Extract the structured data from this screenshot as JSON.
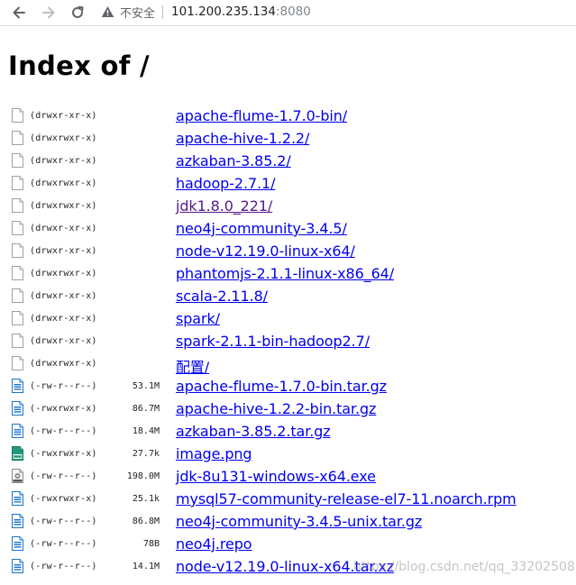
{
  "browser": {
    "security_label": "不安全",
    "url_host": "101.200.235.134",
    "url_port": ":8080"
  },
  "page": {
    "title": "Index of /"
  },
  "entries": [
    {
      "perm": "(drwxr-xr-x)",
      "size": "",
      "name": "apache-flume-1.7.0-bin/",
      "icon": "folder-icon",
      "visited": false
    },
    {
      "perm": "(drwxrwxr-x)",
      "size": "",
      "name": "apache-hive-1.2.2/",
      "icon": "folder-icon",
      "visited": false
    },
    {
      "perm": "(drwxr-xr-x)",
      "size": "",
      "name": "azkaban-3.85.2/",
      "icon": "folder-icon",
      "visited": false
    },
    {
      "perm": "(drwxrwxr-x)",
      "size": "",
      "name": "hadoop-2.7.1/",
      "icon": "folder-icon",
      "visited": false
    },
    {
      "perm": "(drwxrwxr-x)",
      "size": "",
      "name": "jdk1.8.0_221/",
      "icon": "folder-icon",
      "visited": true
    },
    {
      "perm": "(drwxr-xr-x)",
      "size": "",
      "name": "neo4j-community-3.4.5/",
      "icon": "folder-icon",
      "visited": false
    },
    {
      "perm": "(drwxr-xr-x)",
      "size": "",
      "name": "node-v12.19.0-linux-x64/",
      "icon": "folder-icon",
      "visited": false
    },
    {
      "perm": "(drwxrwxr-x)",
      "size": "",
      "name": "phantomjs-2.1.1-linux-x86_64/",
      "icon": "folder-icon",
      "visited": false
    },
    {
      "perm": "(drwxr-xr-x)",
      "size": "",
      "name": "scala-2.11.8/",
      "icon": "folder-icon",
      "visited": false
    },
    {
      "perm": "(drwxr-xr-x)",
      "size": "",
      "name": "spark/",
      "icon": "folder-icon",
      "visited": false
    },
    {
      "perm": "(drwxr-xr-x)",
      "size": "",
      "name": "spark-2.1.1-bin-hadoop2.7/",
      "icon": "folder-icon",
      "visited": false
    },
    {
      "perm": "(drwxrwxr-x)",
      "size": "",
      "name": "配置/",
      "icon": "folder-icon",
      "visited": false
    },
    {
      "perm": "(-rw-r--r--)",
      "size": "53.1M",
      "name": "apache-flume-1.7.0-bin.tar.gz",
      "icon": "archive-icon",
      "visited": false
    },
    {
      "perm": "(-rwxrwxr-x)",
      "size": "86.7M",
      "name": "apache-hive-1.2.2-bin.tar.gz",
      "icon": "archive-icon",
      "visited": false
    },
    {
      "perm": "(-rw-r--r--)",
      "size": "18.4M",
      "name": "azkaban-3.85.2.tar.gz",
      "icon": "archive-icon",
      "visited": false
    },
    {
      "perm": "(-rwxrwxr-x)",
      "size": "27.7k",
      "name": "image.png",
      "icon": "image-icon",
      "visited": false
    },
    {
      "perm": "(-rw-r--r--)",
      "size": "198.0M",
      "name": "jdk-8u131-windows-x64.exe",
      "icon": "exe-icon",
      "visited": false
    },
    {
      "perm": "(-rwxrwxr-x)",
      "size": "25.1k",
      "name": "mysql57-community-release-el7-11.noarch.rpm",
      "icon": "archive-icon",
      "visited": false
    },
    {
      "perm": "(-rw-r--r--)",
      "size": "86.8M",
      "name": "neo4j-community-3.4.5-unix.tar.gz",
      "icon": "archive-icon",
      "visited": false
    },
    {
      "perm": "(-rw-r--r--)",
      "size": "78B",
      "name": "neo4j.repo",
      "icon": "archive-icon",
      "visited": false
    },
    {
      "perm": "(-rw-r--r--)",
      "size": "14.1M",
      "name": "node-v12.19.0-linux-x64.tar.xz",
      "icon": "archive-icon",
      "visited": false
    }
  ],
  "watermark": "https://blog.csdn.net/qq_33202508",
  "colors": {
    "link": "#0000ee",
    "visited": "#551a8b",
    "archive_icon": "#1a73c9",
    "image_icon": "#1e9c7a"
  }
}
